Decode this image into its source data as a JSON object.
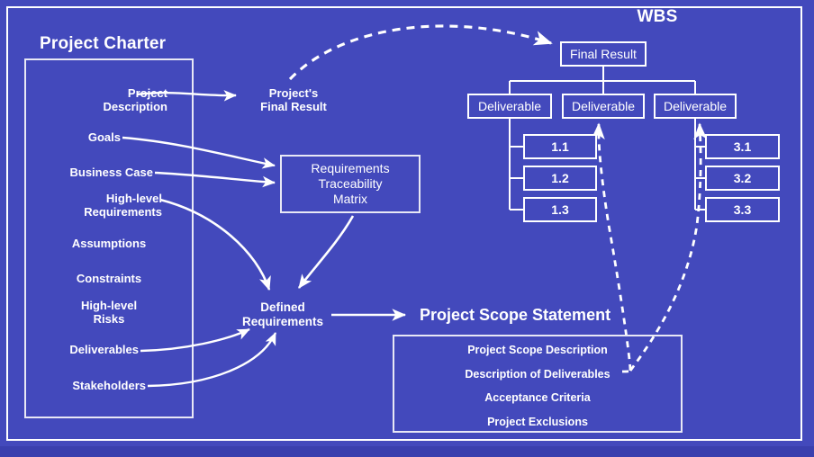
{
  "diagram": {
    "charter_title": "Project Charter",
    "wbs_title": "WBS",
    "scope_title": "Project Scope Statement"
  },
  "charter_items": [
    {
      "label": "Project\nDescription"
    },
    {
      "label": "Goals"
    },
    {
      "label": "Business Case"
    },
    {
      "label": "High-level\nRequirements"
    },
    {
      "label": "Assumptions"
    },
    {
      "label": "Constraints"
    },
    {
      "label": "High-level\nRisks"
    },
    {
      "label": "Deliverables"
    },
    {
      "label": "Stakeholders"
    }
  ],
  "nodes": {
    "project_final_result": "Project's\nFinal Result",
    "rtm": "Requirements\nTraceability\nMatrix",
    "defined_requirements": "Defined\nRequirements"
  },
  "wbs": {
    "root": "Final Result",
    "deliverables": [
      "Deliverable",
      "Deliverable",
      "Deliverable"
    ],
    "branch1": [
      "1.1",
      "1.2",
      "1.3"
    ],
    "branch3": [
      "3.1",
      "3.2",
      "3.3"
    ]
  },
  "scope_statement": {
    "items": [
      "Project Scope Description",
      "Description of Deliverables",
      "Acceptance Criteria",
      "Project Exclusions"
    ]
  },
  "colors": {
    "background": "#4349bc",
    "stroke": "#ffffff",
    "band": "#3a3fae"
  }
}
